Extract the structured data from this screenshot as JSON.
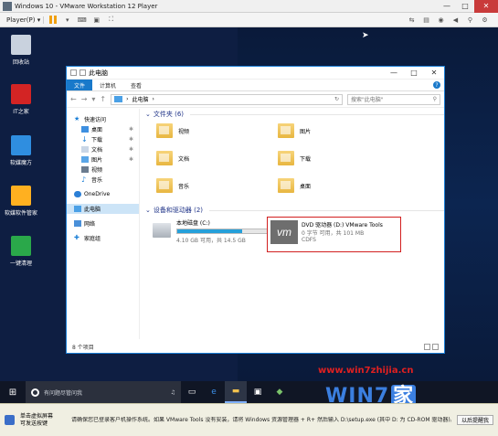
{
  "window": {
    "title": "Windows 10 - VMware Workstation 12 Player",
    "min": "—",
    "max": "□",
    "close": "✕"
  },
  "toolbar": {
    "player_label": "Player(P) ▾",
    "icons": [
      "pause-icon",
      "dropdown-icon",
      "send-keys-icon",
      "unity-icon",
      "fullscreen-icon"
    ],
    "right_icons": [
      "network-icon",
      "printer-icon",
      "cd-icon",
      "sound-icon",
      "usb-icon",
      "settings-icon"
    ]
  },
  "desktop": {
    "icons": [
      {
        "label": "回收站",
        "icon": "recycle-bin-icon",
        "color": "#c9d2de"
      },
      {
        "label": "IT之家",
        "icon": "ithome-icon",
        "color": "#d32424"
      },
      {
        "label": "软媒魔方",
        "icon": "rubik-icon",
        "color": "#2f8ee0"
      },
      {
        "label": "软媒软件管家",
        "icon": "software-manager-icon",
        "color": "#ffb020"
      },
      {
        "label": "一键清理",
        "icon": "cleanup-icon",
        "color": "#2aa84a"
      }
    ]
  },
  "explorer": {
    "title": "此电脑",
    "ribbon_tabs": [
      "文件",
      "计算机",
      "查看"
    ],
    "address": "此电脑",
    "address_sep": "›",
    "search_placeholder": "搜索\"此电脑\"",
    "nav": [
      {
        "label": "快速访问",
        "icon": "star-icon"
      },
      {
        "label": "桌面",
        "icon": "desktop-icon",
        "pin": true
      },
      {
        "label": "下载",
        "icon": "download-icon",
        "pin": true
      },
      {
        "label": "文档",
        "icon": "document-icon",
        "pin": true
      },
      {
        "label": "图片",
        "icon": "picture-icon",
        "pin": true
      },
      {
        "label": "视频",
        "icon": "video-icon"
      },
      {
        "label": "音乐",
        "icon": "music-icon"
      },
      {
        "label": "OneDrive",
        "icon": "cloud-icon"
      },
      {
        "label": "此电脑",
        "icon": "computer-icon",
        "selected": true
      },
      {
        "label": "网络",
        "icon": "network-icon"
      },
      {
        "label": "家庭组",
        "icon": "homegroup-icon"
      }
    ],
    "folders_header": "文件夹 (6)",
    "folders": [
      "视频",
      "图片",
      "文档",
      "下载",
      "音乐",
      "桌面"
    ],
    "drives_header": "设备和驱动器 (2)",
    "local_drive": {
      "name": "本地磁盘 (C:)",
      "free": "4.10 GB 可用，共 14.5 GB",
      "used_fraction": 0.72
    },
    "dvd_drive": {
      "name": "DVD 驱动器 (D:) VMware Tools",
      "free": "0 字节 可用，共 101 MB",
      "fs": "CDFS",
      "logo": "vm"
    },
    "status": "8 个项目"
  },
  "taskbar": {
    "search_placeholder": "有问题尽管问我",
    "icons": [
      "task-view-icon",
      "edge-icon",
      "file-explorer-icon",
      "store-icon",
      "app-icon"
    ]
  },
  "watermark": {
    "url": "www.win7zhijia.cn",
    "logo_text": "WIN7",
    "logo_suffix": "家"
  },
  "vm_bottom_bar": {
    "done_label": "单击虚拟屏幕\n可发送按键",
    "message": "请确保您已登录客户机操作系统。如果 VMware Tools 没有安装，请将 Windows 资源管理器 + R+ 然后输入 D:\\setup.exe (其中 D: 为 CD-ROM 驱动器)。",
    "later_button": "以后提醒我"
  }
}
